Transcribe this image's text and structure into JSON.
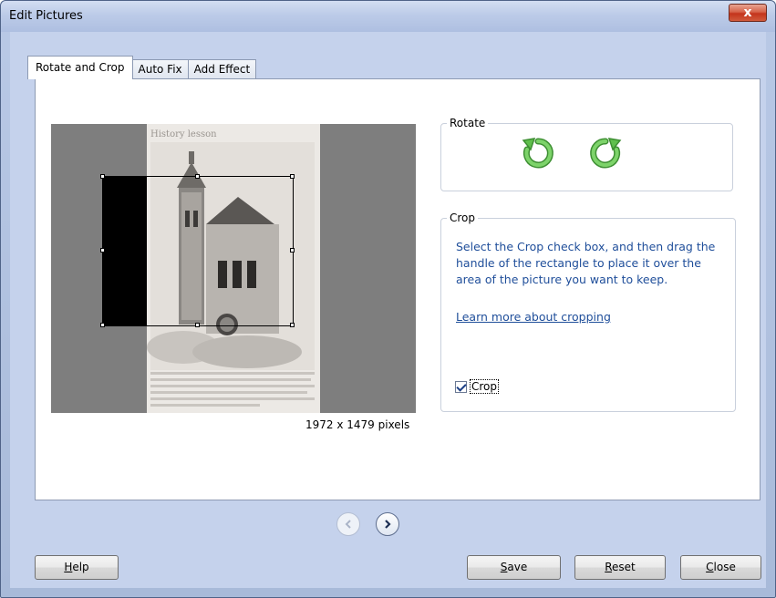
{
  "window": {
    "title": "Edit Pictures",
    "close_label": "x"
  },
  "tabs": [
    {
      "label": "Rotate and Crop",
      "active": true
    },
    {
      "label": "Auto Fix",
      "active": false
    },
    {
      "label": "Add Effect",
      "active": false
    }
  ],
  "preview": {
    "photo_caption": "History lesson",
    "dimensions": "1972 x 1479 pixels"
  },
  "rotate": {
    "group_label": "Rotate",
    "left_icon": "rotate-left-icon",
    "right_icon": "rotate-right-icon"
  },
  "crop": {
    "group_label": "Crop",
    "description": "Select the Crop check box, and then drag the handle of the rectangle to place it over the area of the picture you want to keep.",
    "link": "Learn more about cropping",
    "checkbox_label": "Crop",
    "checked": true
  },
  "nav": {
    "prev_icon": "chevron-left-icon",
    "next_icon": "chevron-right-icon"
  },
  "buttons": {
    "help_u": "H",
    "help_rest": "elp",
    "save_u": "S",
    "save_rest": "ave",
    "reset_u": "R",
    "reset_rest": "eset",
    "close_u": "C",
    "close_rest": "lose"
  },
  "colors": {
    "accent": "#1f4e9a",
    "rotate_green": "#5fbf4c",
    "preview_bg": "#7e7e7e"
  }
}
